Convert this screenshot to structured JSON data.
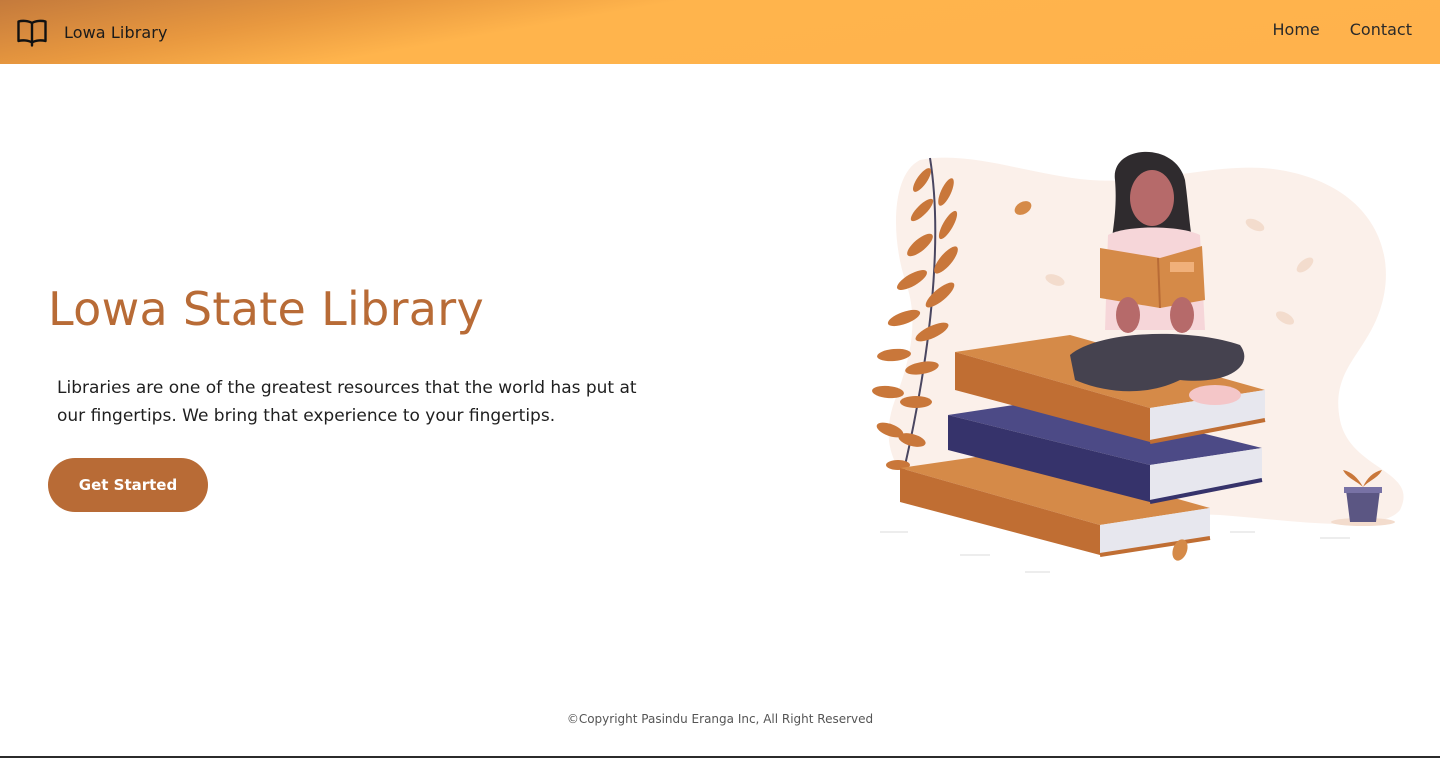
{
  "navbar": {
    "brand_icon": "open-book-icon",
    "brand_name": "Lowa Library",
    "links": [
      {
        "label": "Home"
      },
      {
        "label": "Contact"
      }
    ]
  },
  "hero": {
    "title": "Lowa State Library",
    "description": "Libraries are one of the greatest resources that the world has put at our fingertips. We bring that experience to your fingertips.",
    "cta_label": "Get Started"
  },
  "footer": {
    "copyright": "©Copyright Pasindu Eranga Inc, All Right Reserved"
  },
  "colors": {
    "accent": "#b86b36",
    "nav_gradient_start": "#c47a3c",
    "nav_gradient_end": "#ffb24c",
    "book_blue": "#36336b",
    "blob": "#fbf0ea"
  }
}
